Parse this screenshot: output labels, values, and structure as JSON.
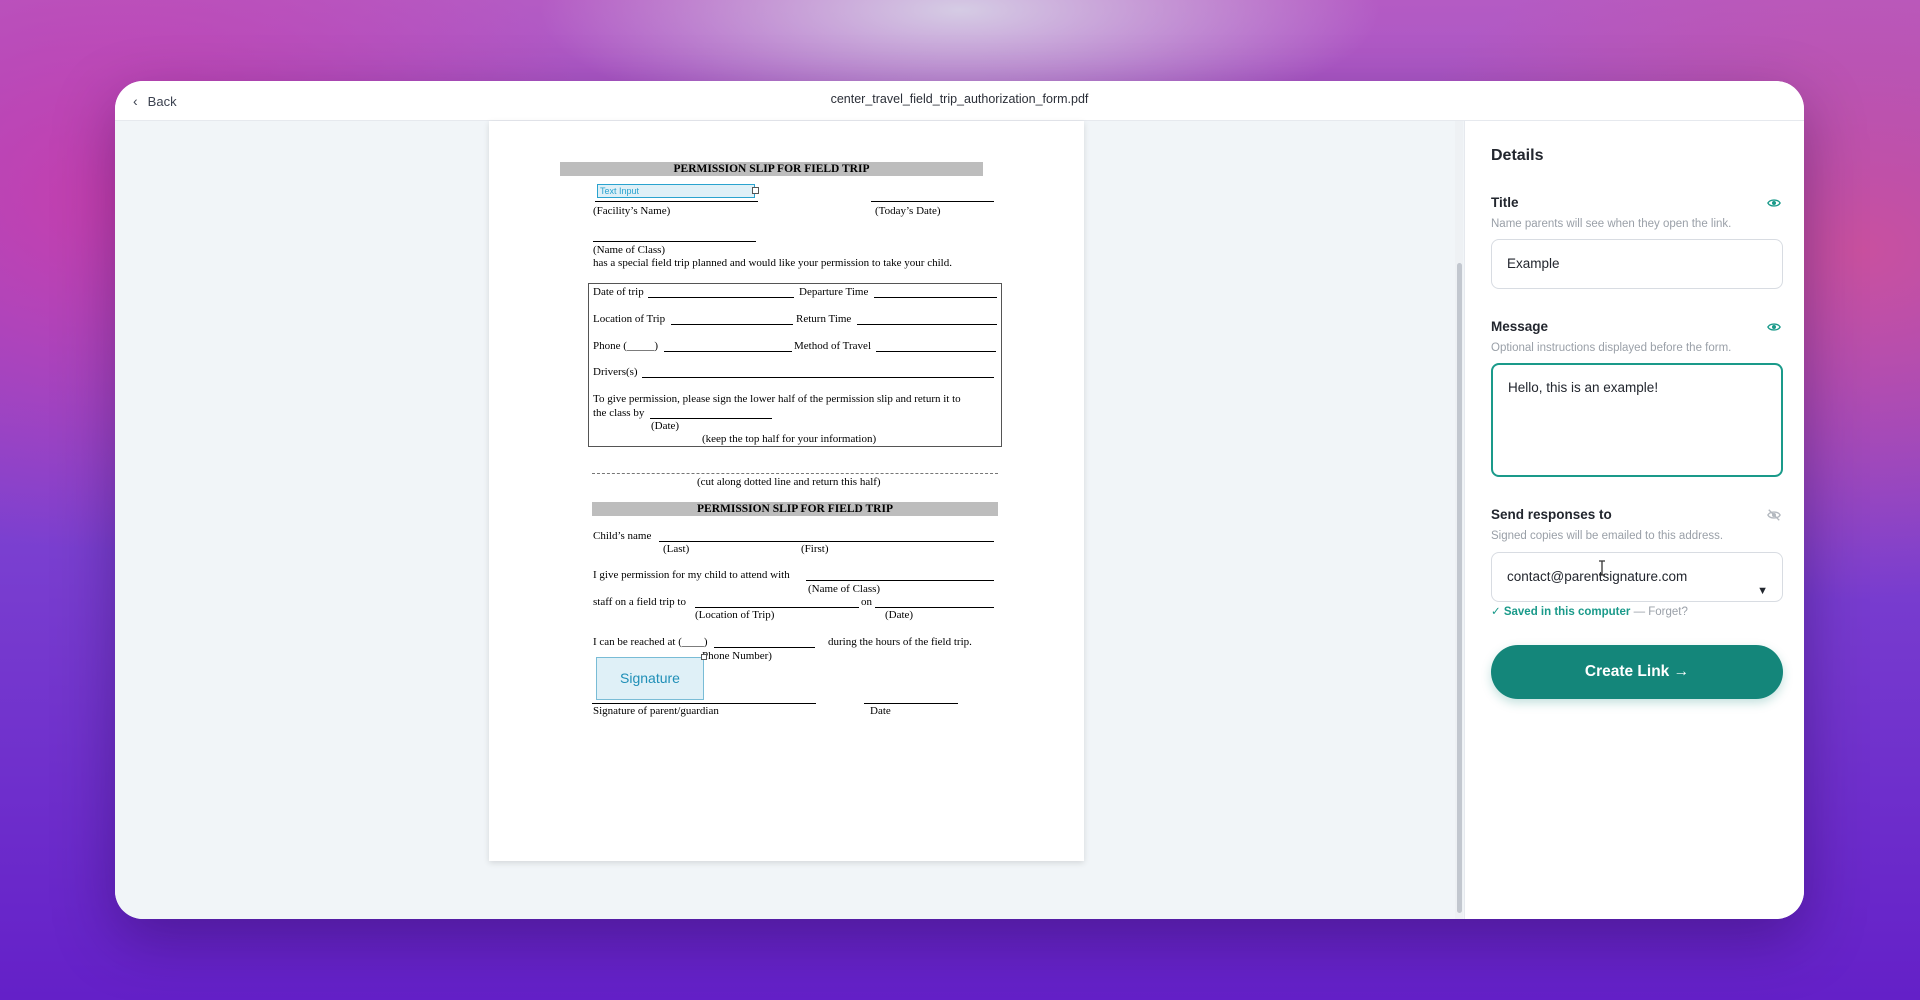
{
  "header": {
    "back_label": "Back",
    "filename": "center_travel_field_trip_authorization_form.pdf"
  },
  "document": {
    "title_top": "PERMISSION SLIP FOR FIELD TRIP",
    "text_input_label": "Text Input",
    "facility_name": "(Facility’s Name)",
    "todays_date": "(Today’s Date)",
    "name_of_class": "(Name of Class)",
    "intro": "has a special field trip planned and would like your permission to take your child.",
    "date_of_trip": "Date of trip",
    "departure_time": "Departure Time",
    "location_of_trip": "Location of Trip",
    "return_time": "Return Time",
    "phone": "Phone (_____)",
    "method_of_travel": "Method of Travel",
    "drivers": "Drivers(s)",
    "give_permission_1": "To give permission, please sign the lower half of the permission slip and return it to",
    "give_permission_2": "the class by",
    "date_label": "(Date)",
    "keep_top": "(keep the top half for your information)",
    "cut_along": "(cut along dotted line and return this half)",
    "title_bottom": "PERMISSION SLIP FOR FIELD TRIP",
    "childs_name": "Child’s name",
    "last": "(Last)",
    "first": "(First)",
    "i_give": "I give permission for my child to attend with",
    "name_of_class_2": "(Name of Class)",
    "staff_on": "staff on a field trip to",
    "on": "on",
    "location_of_trip_2": "(Location of Trip)",
    "date_2": "(Date)",
    "reached_at": "I can be reached at (____)",
    "during_hours": "during the hours of the field trip.",
    "phone_number": "Phone Number)",
    "signature_field": "Signature",
    "signature_of_parent": "Signature of parent/guardian",
    "date_3": "Date"
  },
  "details": {
    "heading": "Details",
    "title_label": "Title",
    "title_hint": "Name parents will see when they open the link.",
    "title_value": "Example",
    "message_label": "Message",
    "message_hint": "Optional instructions displayed before the form.",
    "message_value": "Hello, this is an example!",
    "send_label": "Send responses to",
    "send_hint": "Signed copies will be emailed to this address.",
    "send_value": "contact@parentsignature.com",
    "saved_text": "✓ Saved in this computer",
    "forget_text": "— Forget?",
    "cta_label": "Create Link →"
  },
  "colors": {
    "accent": "#14867a",
    "field_highlight": "#dff0f7"
  },
  "icons": [
    "chevron-left-icon",
    "eye-icon",
    "eye-off-icon",
    "dropdown-arrow-icon",
    "text-cursor-icon"
  ]
}
